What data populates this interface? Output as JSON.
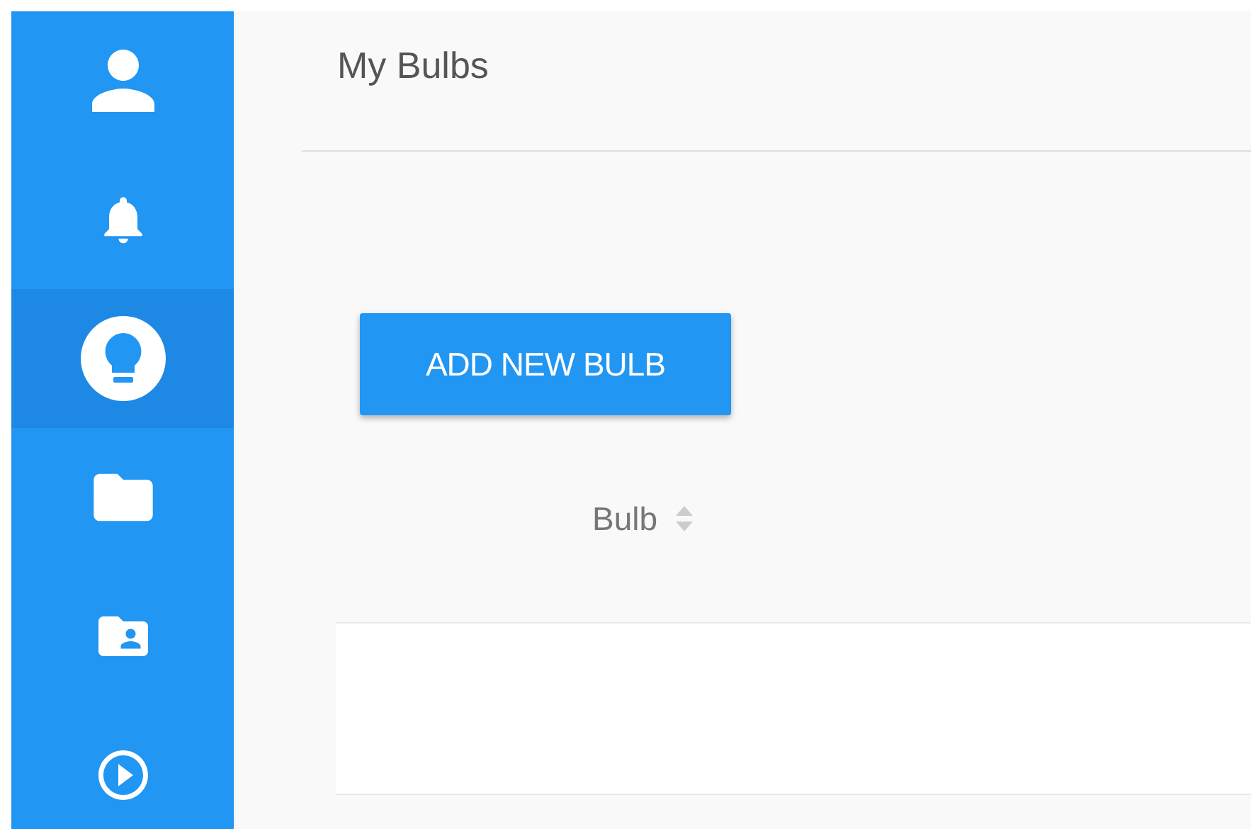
{
  "sidebar": {
    "items": [
      {
        "kind": "person",
        "selected": false
      },
      {
        "kind": "bell",
        "selected": false
      },
      {
        "kind": "bulb",
        "selected": true
      },
      {
        "kind": "folder",
        "selected": false
      },
      {
        "kind": "shared-folder",
        "selected": false
      },
      {
        "kind": "play",
        "selected": false
      }
    ]
  },
  "header": {
    "title": "My Bulbs"
  },
  "add_button": {
    "label": "ADD NEW BULB"
  },
  "table": {
    "columns": [
      {
        "label": "Bulb",
        "sortable": true
      }
    ]
  }
}
